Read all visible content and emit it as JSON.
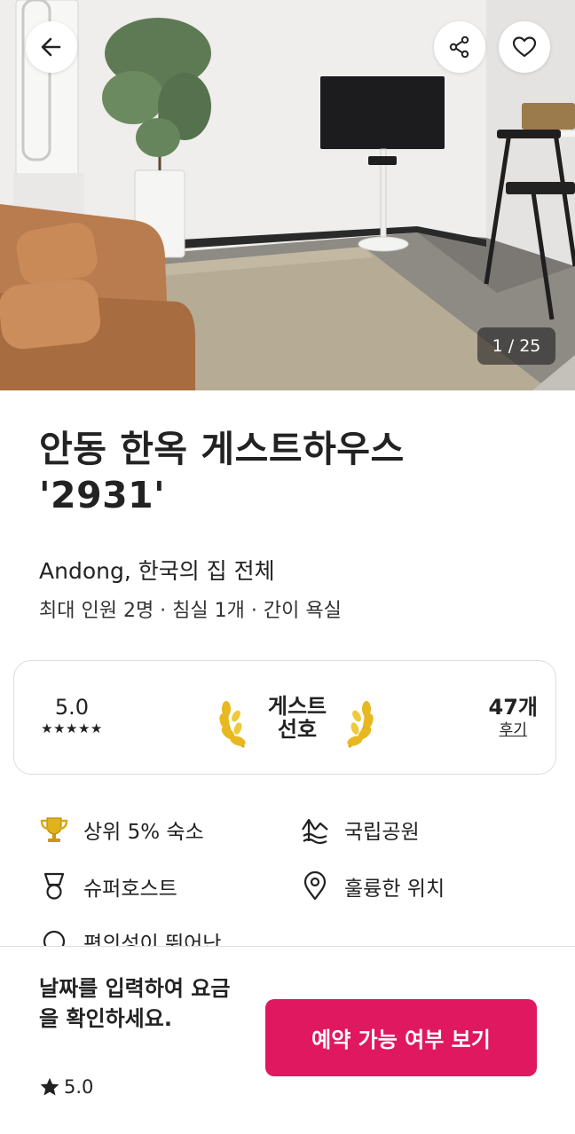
{
  "photo": {
    "counter": "1 / 25",
    "icons": {
      "back": "arrow-left-icon",
      "share": "share-icon",
      "favorite": "heart-outline-icon"
    }
  },
  "listing": {
    "title": "안동 한옥 게스트하우스 '2931'",
    "subtitle": "Andong, 한국의 집 전체",
    "details": "최대 인원 2명 · 침실 1개 · 간이 욕실"
  },
  "stats": {
    "rating": "5.0",
    "stars": "★★★★★",
    "guest_favorite_line1": "게스트",
    "guest_favorite_line2": "선호",
    "reviews_count": "47개",
    "reviews_label": "후기"
  },
  "highlights": [
    {
      "icon": "trophy-icon",
      "label": "상위 5% 숙소"
    },
    {
      "icon": "mountain-icon",
      "label": "국립공원"
    },
    {
      "icon": "medal-icon",
      "label": "슈퍼호스트"
    },
    {
      "icon": "location-pin-icon",
      "label": "훌륭한 위치"
    },
    {
      "icon": "comfort-icon",
      "label": "편의성이 뛰어난"
    }
  ],
  "footer": {
    "price_prompt": "날짜를 입력하여 요금을 확인하세요.",
    "rating": "5.0",
    "reserve_button": "예약 가능 여부 보기"
  },
  "colors": {
    "brand": "#E0185F",
    "text": "#222222",
    "border": "#DDDDDD",
    "gold": "#E0B21C"
  }
}
